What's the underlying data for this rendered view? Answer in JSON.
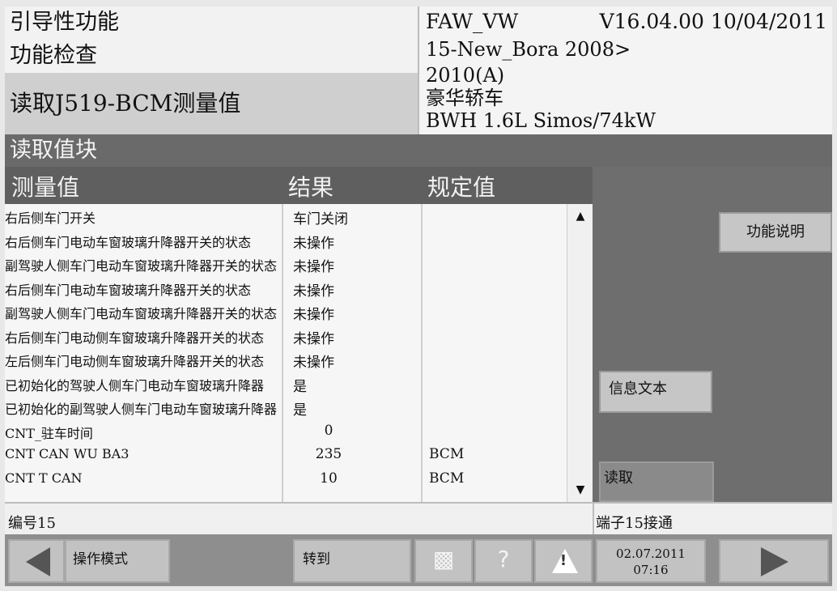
{
  "header": {
    "title1": "引导性功能",
    "title2": "功能检查",
    "title3": "读取J519-BCM测量值",
    "brand": "FAW_VW",
    "version": "V16.04.00 10/04/2011",
    "model_line1": "15-New_Bora 2008>",
    "model_line2": "2010(A)",
    "body_type": "豪华轿车",
    "engine": "BWH 1.6L Simos/74kW"
  },
  "section_title": "读取值块",
  "columns": {
    "measure": "测量值",
    "result": "结果",
    "spec": "规定值"
  },
  "rows": [
    {
      "name": "右后侧车门开关",
      "result": "车门关闭",
      "spec": ""
    },
    {
      "name": "右后侧车门电动车窗玻璃升降器开关的状态",
      "result": "未操作",
      "spec": ""
    },
    {
      "name": "副驾驶人侧车门电动车窗玻璃升降器开关的状态",
      "result": "未操作",
      "spec": ""
    },
    {
      "name": "右后侧车门电动车窗玻璃升降器开关的状态",
      "result": "未操作",
      "spec": ""
    },
    {
      "name": "副驾驶人侧车门电动车窗玻璃升降器开关的状态",
      "result": "未操作",
      "spec": ""
    },
    {
      "name": "右后侧车门电动侧车窗玻璃升降器开关的状态",
      "result": "未操作",
      "spec": ""
    },
    {
      "name": "左后侧车门电动侧车窗玻璃升降器开关的状态",
      "result": "未操作",
      "spec": ""
    },
    {
      "name": "已初始化的驾驶人侧车门电动车窗玻璃升降器",
      "result": "是",
      "spec": ""
    },
    {
      "name": "已初始化的副驾驶人侧车门电动车窗玻璃升降器",
      "result": "是",
      "spec": ""
    },
    {
      "name": "CNT_驻车时间",
      "result": "0",
      "spec": ""
    },
    {
      "name": "CNT CAN WU BA3",
      "result": "235",
      "spec": "BCM"
    },
    {
      "name": "CNT T CAN",
      "result": "10",
      "spec": "BCM"
    }
  ],
  "side_buttons": {
    "function_desc": "功能说明",
    "info_text": "信息文本",
    "read": "读取"
  },
  "status": {
    "left": "编号15",
    "right": "端子15接通"
  },
  "toolbar": {
    "mode": "操作模式",
    "goto": "转到",
    "help": "?",
    "date": "02.07.2011",
    "time": "07:16"
  },
  "icons": [
    "arrow-left-icon",
    "print-icon",
    "help-icon",
    "warning-icon",
    "arrow-right-icon",
    "scroll-up-icon",
    "scroll-down-icon"
  ]
}
